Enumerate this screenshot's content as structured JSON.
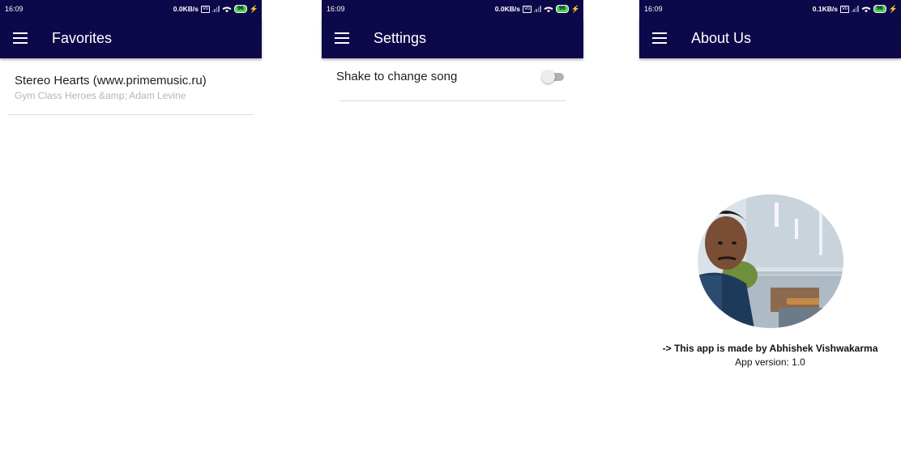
{
  "status_bar": {
    "time": "16:09",
    "battery": "96",
    "screens_net": [
      "0.0KB/s",
      "0.0KB/s",
      "0.1KB/s"
    ],
    "volte": "Vo"
  },
  "favorites": {
    "title": "Favorites",
    "items": [
      {
        "title": "Stereo Hearts (www.primemusic.ru)",
        "artist": "Gym Class Heroes &amp; Adam Levine"
      }
    ]
  },
  "settings": {
    "title": "Settings",
    "shake_label": "Shake to change song",
    "shake_enabled": false
  },
  "about": {
    "title": "About Us",
    "made_by": "-> This app is made by Abhishek Vishwakarma",
    "version": "App version: 1.0"
  },
  "colors": {
    "primary_dark": "#0c0849",
    "battery_green": "#4bd14b",
    "divider": "#dcdcdc",
    "secondary_text": "#b5b5b5"
  },
  "icons": [
    "menu-icon",
    "wifi-icon",
    "signal-icon",
    "battery-icon",
    "charging-icon",
    "volte-icon"
  ]
}
